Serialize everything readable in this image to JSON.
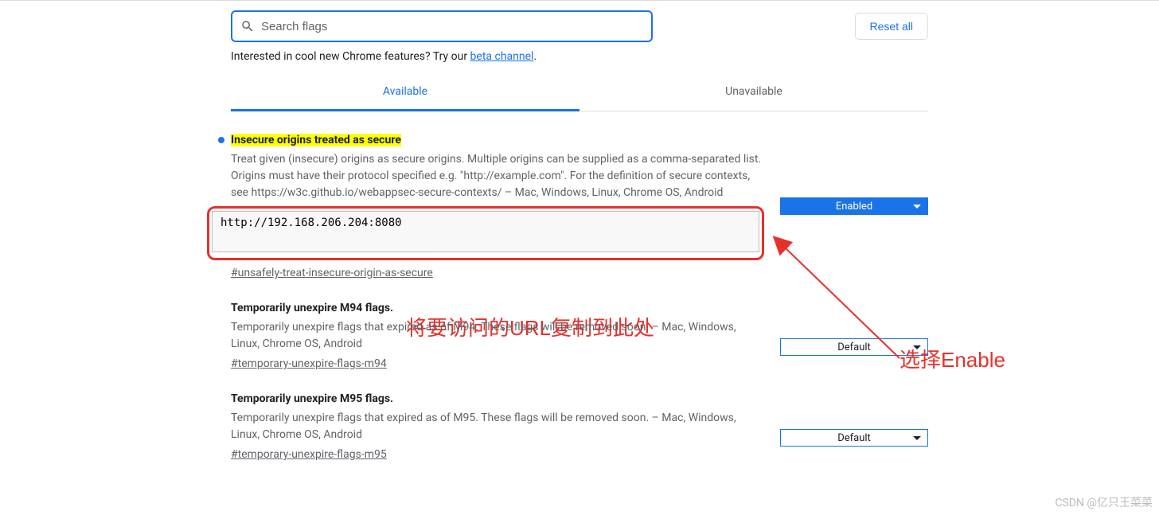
{
  "search": {
    "placeholder": "Search flags"
  },
  "reset_label": "Reset all",
  "promo": {
    "text_before": "Interested in cool new Chrome features? Try our ",
    "link_text": "beta channel",
    "text_after": "."
  },
  "tabs": {
    "available": "Available",
    "unavailable": "Unavailable"
  },
  "flags": [
    {
      "title": "Insecure origins treated as secure",
      "desc": "Treat given (insecure) origins as secure origins. Multiple origins can be supplied as a comma-separated list. Origins must have their protocol specified e.g. \"http://example.com\". For the definition of secure contexts, see https://w3c.github.io/webappsec-secure-contexts/ – Mac, Windows, Linux, Chrome OS, Android",
      "input_value": "http://192.168.206.204:8080",
      "anchor": "#unsafely-treat-insecure-origin-as-secure",
      "dropdown": "Enabled"
    },
    {
      "title": "Temporarily unexpire M94 flags.",
      "desc": "Temporarily unexpire flags that expired as of M94. These flags will be removed soon. – Mac, Windows, Linux, Chrome OS, Android",
      "anchor": "#temporary-unexpire-flags-m94",
      "dropdown": "Default"
    },
    {
      "title": "Temporarily unexpire M95 flags.",
      "desc": "Temporarily unexpire flags that expired as of M95. These flags will be removed soon. – Mac, Windows, Linux, Chrome OS, Android",
      "anchor": "#temporary-unexpire-flags-m95",
      "dropdown": "Default"
    }
  ],
  "annotations": {
    "url_hint": "将要访问的URL复制到此处",
    "enable_hint": "选择Enable"
  },
  "watermark": "CSDN @亿只王菜菜"
}
